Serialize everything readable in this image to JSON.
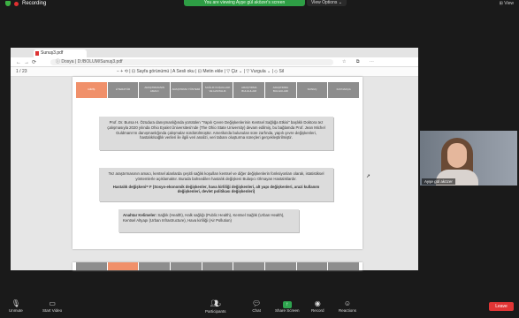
{
  "zoom": {
    "recording_label": "Recording",
    "share_banner": "You are viewing Ayşe gül aközer's screen",
    "view_options": "View Options ⌄",
    "view_button": "⊞ View"
  },
  "browser": {
    "tab_title": "Sunuş3.pdf",
    "address": "ⓘ Dosya | D:/BOLUM/Sunuş3.pdf",
    "page_indicator": "1 / 23",
    "pdf_tools": "− + ⟲ | ⊡ Sayfa görünümü | A Sesli oku | ⊡ Metin ekle | ▽ Çiz ⌄ | ▽ Vurgula ⌄ | ◇ Sil"
  },
  "slide": {
    "nav_items": [
      "GİRİŞ",
      "LİTERATÜR",
      "ARAŞTIRMANIN AMACI",
      "ARAŞTIRMA YÖNTEMİ",
      "SAĞLIK KOŞULLARI VE HASTALIK",
      "ARAŞTIRMA BULGULARI",
      "ARAŞTIRMA BULGULARI",
      "SONUÇ",
      "KAYNAKÇA"
    ],
    "active_index": 0,
    "card1_text": "Prof. Dr. Bursa H. Özüdura danışmanlığında yürütülen \"Yapılı Çevre Değişkenlerinin Kentsel Sağlığa Etkisi\" başlıklı Doktora tez çalışmasıyla 2020 yılında Ohio Eyalet Üniversitesi'nde (The Ohio State University) devam edilmiş, bu bağlamda Prof. Jean Michel Guldmann'ın danışmanlığında çalışmalar sürdürülmüştür. Amerika'da bulunulan süre zarfında, yapılı çevre değişkenleri, hastalık/sağlık verileri ile ilgili veri analizi, veri tabanı oluşturma süreçleri gerçekleştirilmiştir.",
    "card2_text": "Tez araştırmasının amacı, kentsel alanlarda çeşitli sağlık koşulları kentsel ve diğer değişkenlerin fonksiyonları olarak, istatistiksel yöntemlerle açıklamaktır. Burada bahsedilen hastalık değişkeni Bulaşıcı Olmayan Hastalıklardır.",
    "card2_bold": "Hastalık değişkeni= F (Sosyo-ekonomik değişkenler, hava kirliliği değişkenleri, alt yapı değişkenleri, arazi kullanım değişkenleri, devlet politikası değişkenleri)",
    "card3_label": "Anahtar Kelimeler:",
    "card3_text": "Sağlık (Health), Halk sağlığı (Public Health), Kentsel Sağlık (Urban Health), Kentsel Altyapı (Urban Infrastructure), Hava kirliliği (Air Pollution)"
  },
  "participant": {
    "name": "Ayşe gül aközer"
  },
  "toolbar": {
    "unmute": "Unmute",
    "start_video": "Start Video",
    "participants": "Participants",
    "participants_count": "2",
    "chat": "Chat",
    "share_screen": "Share Screen",
    "record": "Record",
    "reactions": "Reactions",
    "leave": "Leave"
  },
  "colors": {
    "share_green": "#2e9e45",
    "leave_red": "#e03535",
    "active_nav": "#f0906a",
    "nav_gray": "#8d8d8d"
  }
}
